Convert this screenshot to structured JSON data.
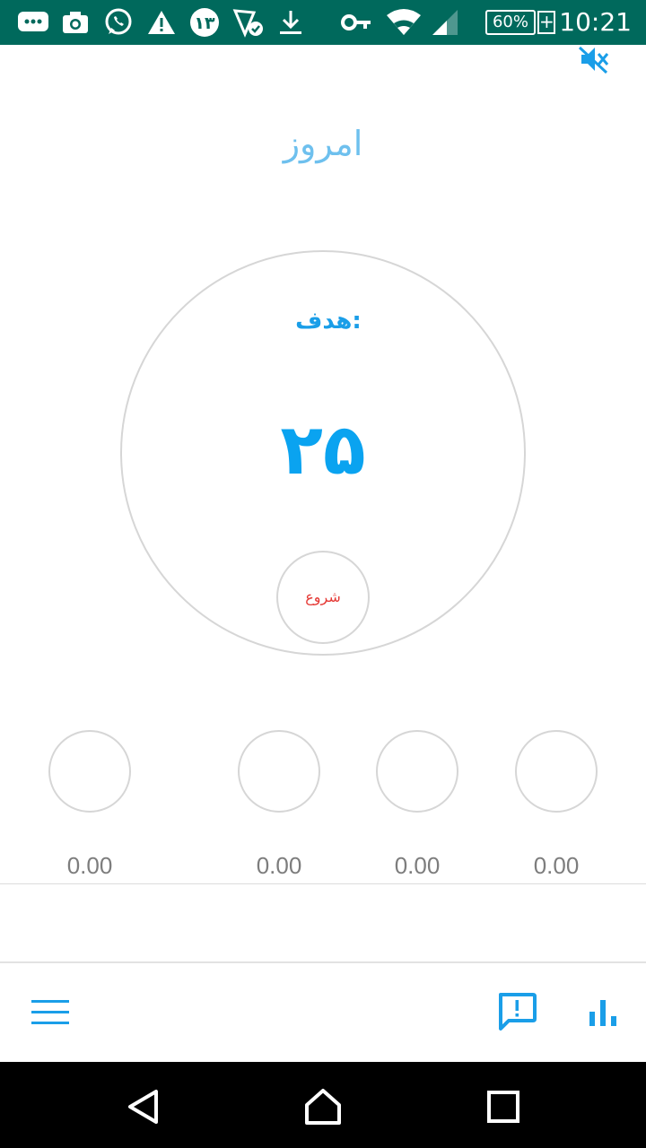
{
  "status_bar": {
    "icons": [
      "chat-bubble-icon",
      "camera-icon",
      "whatsapp-icon",
      "warning-icon",
      "number-badge-icon",
      "network-check-icon",
      "download-icon",
      "vpn-key-icon",
      "wifi-icon",
      "cell-signal-icon",
      "battery-icon"
    ],
    "badge_number": "۱۳",
    "battery_percent": "60%",
    "battery_plus": "+",
    "time": "10:21",
    "background": "#00695c"
  },
  "header": {
    "mute_icon": "volume-off-icon",
    "title": "امروز"
  },
  "goal": {
    "label": "هدف:",
    "value": "۲۵",
    "start_label": "شروع",
    "accent": "#0aa3f0",
    "start_color": "#e53935"
  },
  "stats": [
    {
      "value": "0.00"
    },
    {
      "value": "0.00"
    },
    {
      "value": "0.00"
    },
    {
      "value": "0.00"
    }
  ],
  "toolbar": {
    "icons": [
      "menu-icon",
      "feedback-icon",
      "bar-chart-icon"
    ],
    "icon_color": "#1a9ee8"
  },
  "nav_bar": {
    "icons": [
      "back-icon",
      "home-icon",
      "recents-icon"
    ]
  }
}
